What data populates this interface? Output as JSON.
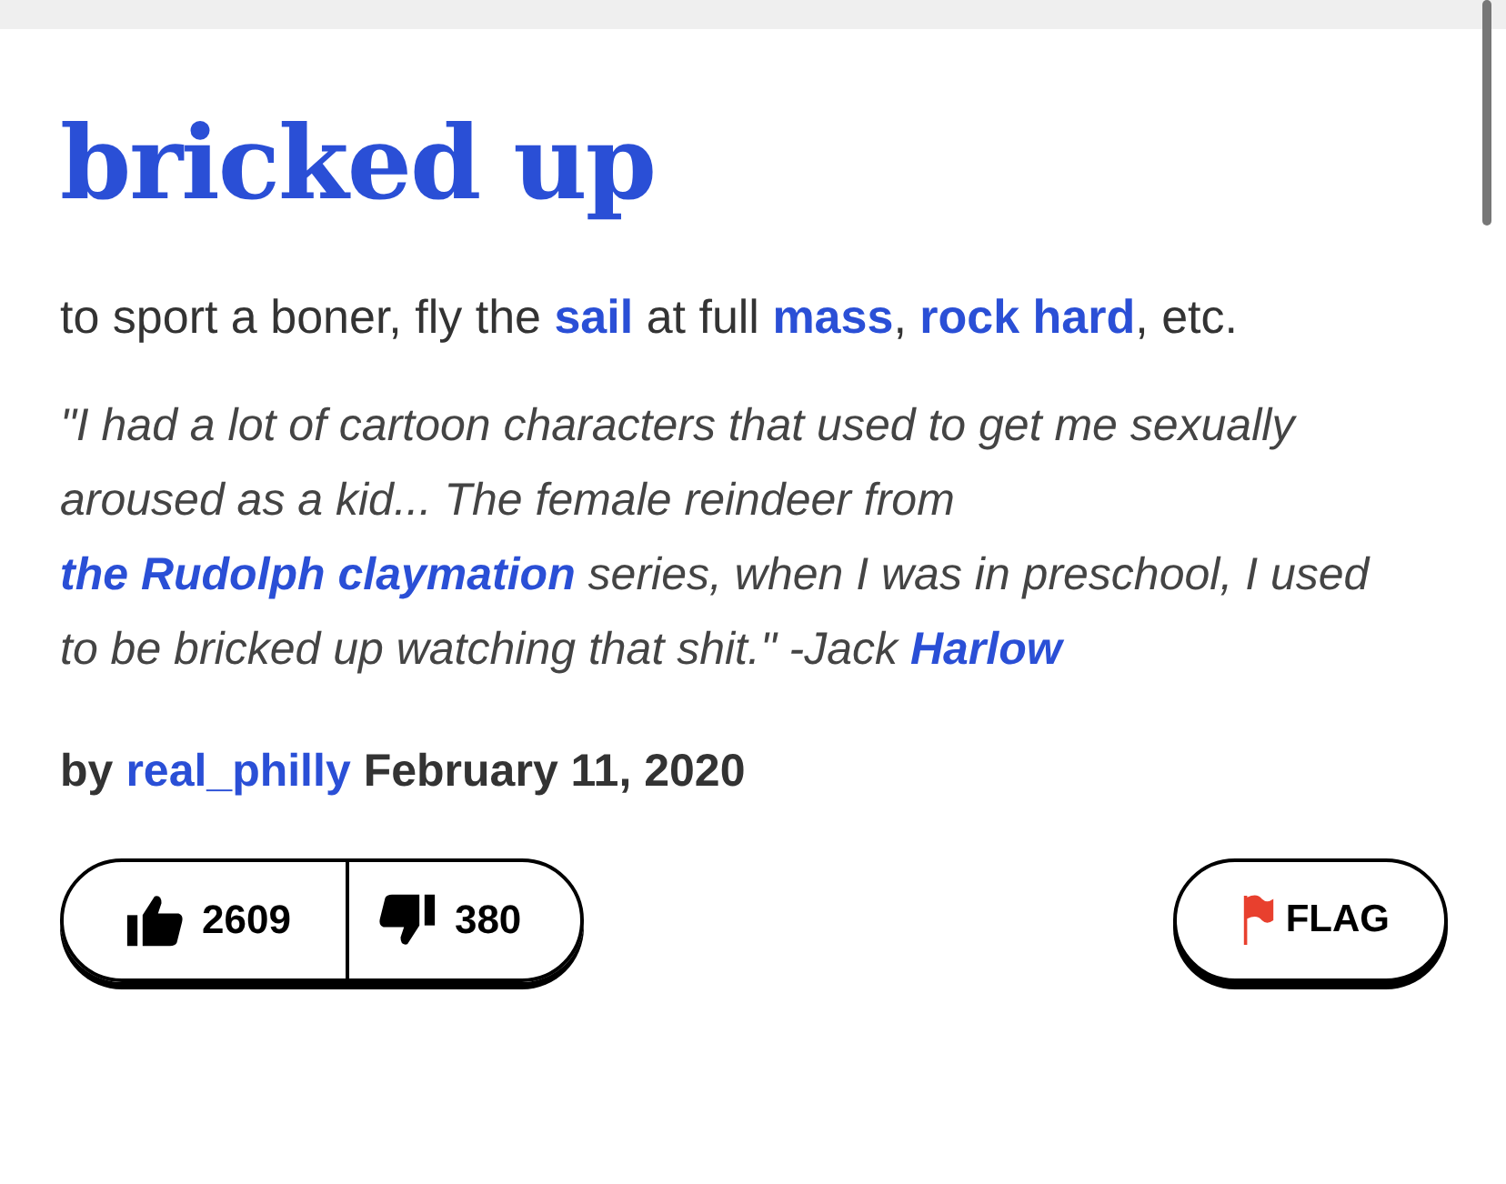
{
  "entry": {
    "word": "bricked up",
    "definition": [
      {
        "kind": "text",
        "text": "to sport a boner, fly the "
      },
      {
        "kind": "link",
        "text": "sail"
      },
      {
        "kind": "text",
        "text": " at full "
      },
      {
        "kind": "link",
        "text": "mass"
      },
      {
        "kind": "text",
        "text": ", "
      },
      {
        "kind": "link",
        "text": "rock hard"
      },
      {
        "kind": "text",
        "text": ", etc."
      }
    ],
    "example": [
      {
        "kind": "text",
        "text": "\"I had a lot of cartoon characters that used to get me sexually aroused as a kid... The female reindeer from "
      },
      {
        "kind": "link",
        "text": "the Rudolph claymation"
      },
      {
        "kind": "text",
        "text": " series, when I was in preschool, I used to be bricked up watching that shit.\" -Jack "
      },
      {
        "kind": "link",
        "text": "Harlow"
      }
    ],
    "byline": {
      "prefix": "by",
      "author": "real_philly",
      "date": "February 11, 2020"
    },
    "votes": {
      "up": "2609",
      "down": "380"
    },
    "flag": {
      "label": "FLAG"
    }
  }
}
